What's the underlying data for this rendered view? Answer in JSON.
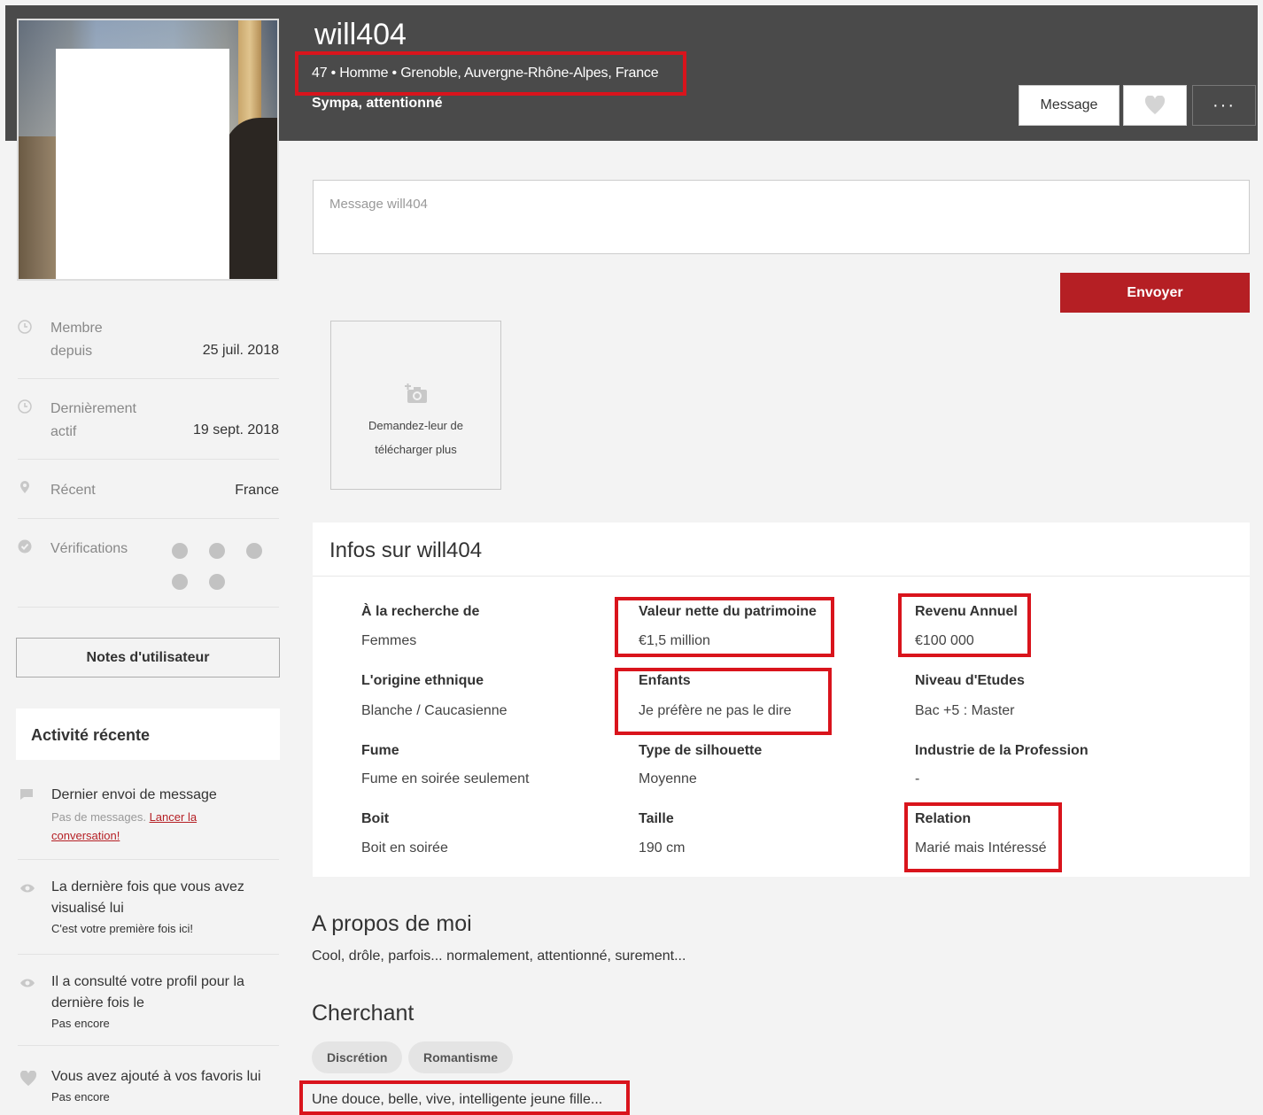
{
  "header": {
    "username": "will404",
    "meta": "47 • Homme • Grenoble, Auvergne-Rhône-Alpes, France",
    "tagline": "Sympa, attentionné",
    "message_button": "Message",
    "more_button": "···"
  },
  "compose": {
    "placeholder": "Message will404",
    "send_label": "Envoyer"
  },
  "upload": {
    "text": "Demandez-leur de télécharger plus"
  },
  "sidebar": {
    "member_since_label_1": "Membre",
    "member_since_label_2": "depuis",
    "member_since_value": "25 juil. 2018",
    "last_active_label_1": "Dernièrement",
    "last_active_label_2": "actif",
    "last_active_value": "19 sept. 2018",
    "recent_label": "Récent",
    "recent_value": "France",
    "verifications_label": "Vérifications",
    "notes_button": "Notes d'utilisateur",
    "activity_title": "Activité récente",
    "activity": [
      {
        "title": "Dernier envoi de message",
        "sub": "Pas de messages.",
        "link": "Lancer la conversation!"
      },
      {
        "title": "La dernière fois que vous avez visualisé lui",
        "sub": "C'est votre première fois ici!"
      },
      {
        "title": "Il a consulté votre profil pour la dernière fois le",
        "sub": "Pas encore"
      },
      {
        "title": "Vous avez ajouté à vos favoris lui",
        "sub": "Pas encore"
      }
    ]
  },
  "info": {
    "title": "Infos sur will404",
    "fields": [
      {
        "label": "À la recherche de",
        "value": "Femmes"
      },
      {
        "label": "Valeur nette du patrimoine",
        "value": "€1,5 million"
      },
      {
        "label": "Revenu Annuel",
        "value": "€100 000"
      },
      {
        "label": "L'origine ethnique",
        "value": "Blanche / Caucasienne"
      },
      {
        "label": "Enfants",
        "value": "Je préfère ne pas le dire"
      },
      {
        "label": "Niveau d'Etudes",
        "value": "Bac +5 : Master"
      },
      {
        "label": "Fume",
        "value": "Fume en soirée seulement"
      },
      {
        "label": "Type de silhouette",
        "value": "Moyenne"
      },
      {
        "label": "Industrie de la Profession",
        "value": "-"
      },
      {
        "label": "Boit",
        "value": "Boit en soirée"
      },
      {
        "label": "Taille",
        "value": "190 cm"
      },
      {
        "label": "Relation",
        "value": "Marié mais Intéressé"
      }
    ]
  },
  "about": {
    "title": "A propos de moi",
    "text": "Cool, drôle, parfois... normalement, attentionné, surement..."
  },
  "seeking": {
    "title": "Cherchant",
    "tags": [
      "Discrétion",
      "Romantisme"
    ],
    "text": "Une douce, belle, vive, intelligente jeune fille..."
  },
  "colors": {
    "header_bg": "#4a4a4a",
    "accent": "#b51f24",
    "highlight": "#d9141c"
  }
}
